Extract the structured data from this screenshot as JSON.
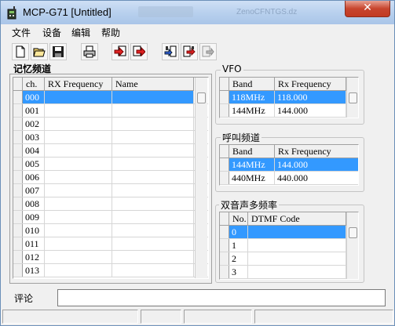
{
  "window": {
    "title": "MCP-G71 [Untitled]",
    "background_title_hint": "ZenoCFNTGS.dz",
    "close_label": "✕"
  },
  "menu": {
    "items": [
      "文件",
      "设备",
      "编辑",
      "帮助"
    ]
  },
  "toolbar": {
    "buttons": [
      "new-icon",
      "open-icon",
      "save-icon",
      "print-icon",
      "import-icon",
      "export-icon",
      "read-from-radio-icon",
      "write-to-radio-icon",
      "disabled-icon"
    ]
  },
  "memory": {
    "title": "记忆频道",
    "columns": [
      "ch.",
      "RX Frequency",
      "Name"
    ],
    "selected_row": 0,
    "rows": [
      {
        "ch": "000",
        "rx": "",
        "name": ""
      },
      {
        "ch": "001",
        "rx": "",
        "name": ""
      },
      {
        "ch": "002",
        "rx": "",
        "name": ""
      },
      {
        "ch": "003",
        "rx": "",
        "name": ""
      },
      {
        "ch": "004",
        "rx": "",
        "name": ""
      },
      {
        "ch": "005",
        "rx": "",
        "name": ""
      },
      {
        "ch": "006",
        "rx": "",
        "name": ""
      },
      {
        "ch": "007",
        "rx": "",
        "name": ""
      },
      {
        "ch": "008",
        "rx": "",
        "name": ""
      },
      {
        "ch": "009",
        "rx": "",
        "name": ""
      },
      {
        "ch": "010",
        "rx": "",
        "name": ""
      },
      {
        "ch": "011",
        "rx": "",
        "name": ""
      },
      {
        "ch": "012",
        "rx": "",
        "name": ""
      },
      {
        "ch": "013",
        "rx": "",
        "name": ""
      }
    ]
  },
  "vfo": {
    "title": "VFO",
    "columns": [
      "Band",
      "Rx Frequency"
    ],
    "rows": [
      {
        "band": "118MHz",
        "rx": "118.000"
      },
      {
        "band": "144MHz",
        "rx": "144.000"
      }
    ]
  },
  "call": {
    "title": "呼叫频道",
    "columns": [
      "Band",
      "Rx Frequency"
    ],
    "rows": [
      {
        "band": "144MHz",
        "rx": "144.000"
      },
      {
        "band": "440MHz",
        "rx": "440.000"
      }
    ]
  },
  "dtmf": {
    "title": "双音声多频率",
    "columns": [
      "No.",
      "DTMF Code"
    ],
    "rows": [
      {
        "no": "0",
        "code": ""
      },
      {
        "no": "1",
        "code": ""
      },
      {
        "no": "2",
        "code": ""
      },
      {
        "no": "3",
        "code": ""
      }
    ]
  },
  "comment": {
    "label": "评论",
    "value": ""
  },
  "colors": {
    "selection": "#3399ff",
    "titlebar": "#b9d1ee",
    "close": "#c7452e"
  }
}
